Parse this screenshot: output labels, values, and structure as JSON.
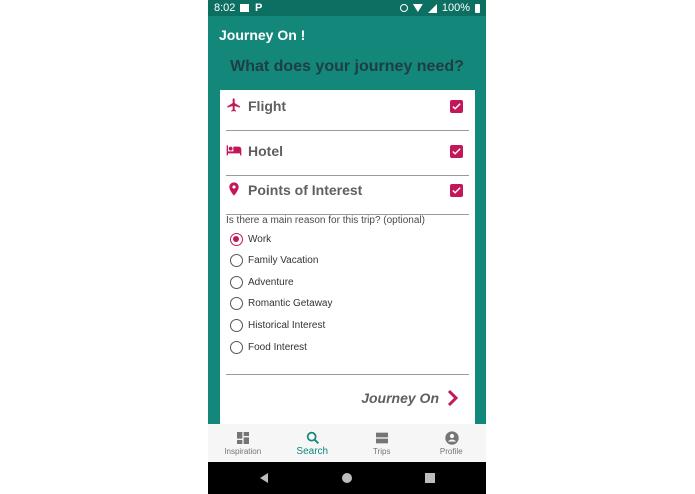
{
  "status_bar": {
    "time": "8:02",
    "notif_p": "P",
    "battery": "100%"
  },
  "app_bar": {
    "title": "Journey On !"
  },
  "prompt": "What does your journey need?",
  "needs": [
    {
      "label": "Flight",
      "icon": "airplane-icon",
      "checked": true
    },
    {
      "label": "Hotel",
      "icon": "bed-icon",
      "checked": true
    },
    {
      "label": "Points of Interest",
      "icon": "map-pin-icon",
      "checked": true
    }
  ],
  "reason": {
    "question": "Is there a main reason for this trip? (optional)",
    "selected": "Work",
    "options": [
      "Work",
      "Family Vacation",
      "Adventure",
      "Romantic Getaway",
      "Historical Interest",
      "Food Interest"
    ]
  },
  "journey_button": {
    "label": "Journey On"
  },
  "bottom_nav": {
    "active": "Search",
    "items": [
      {
        "label": "Inspiration",
        "icon": "dashboard-icon"
      },
      {
        "label": "Search",
        "icon": "search-icon"
      },
      {
        "label": "Trips",
        "icon": "list-icon"
      },
      {
        "label": "Profile",
        "icon": "account-icon"
      }
    ]
  },
  "colors": {
    "primary": "#13887a",
    "primary_dark": "#0d6e62",
    "accent": "#c2185b",
    "heading": "#1f3d45"
  }
}
